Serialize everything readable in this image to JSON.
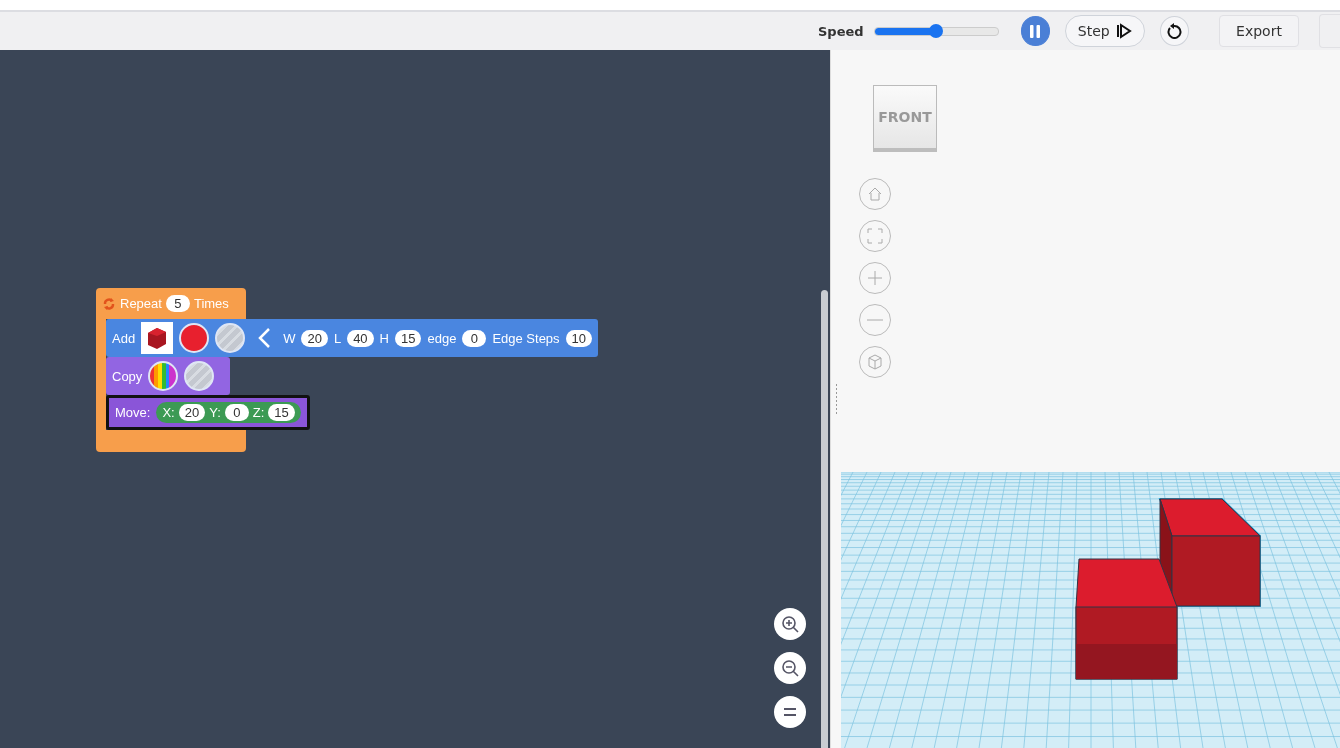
{
  "toolbar": {
    "speed_label": "Speed",
    "speed": {
      "level": 0.5
    },
    "step_button": "Step",
    "export_button": "Export"
  },
  "blocks": {
    "repeat": {
      "label": "Repeat",
      "count": "5",
      "suffix": "Times"
    },
    "add": {
      "label": "Add",
      "params": [
        {
          "label": "W",
          "value": "20"
        },
        {
          "label": "L",
          "value": "40"
        },
        {
          "label": "H",
          "value": "15"
        },
        {
          "label": "edge",
          "value": "0"
        },
        {
          "label": "Edge Steps",
          "value": "10"
        }
      ]
    },
    "copy": {
      "label": "Copy"
    },
    "move": {
      "label": "Move:",
      "params": [
        {
          "label": "X:",
          "value": "20"
        },
        {
          "label": "Y:",
          "value": "0"
        },
        {
          "label": "Z:",
          "value": "15"
        }
      ]
    }
  },
  "view_cube": {
    "label": "FRONT"
  }
}
